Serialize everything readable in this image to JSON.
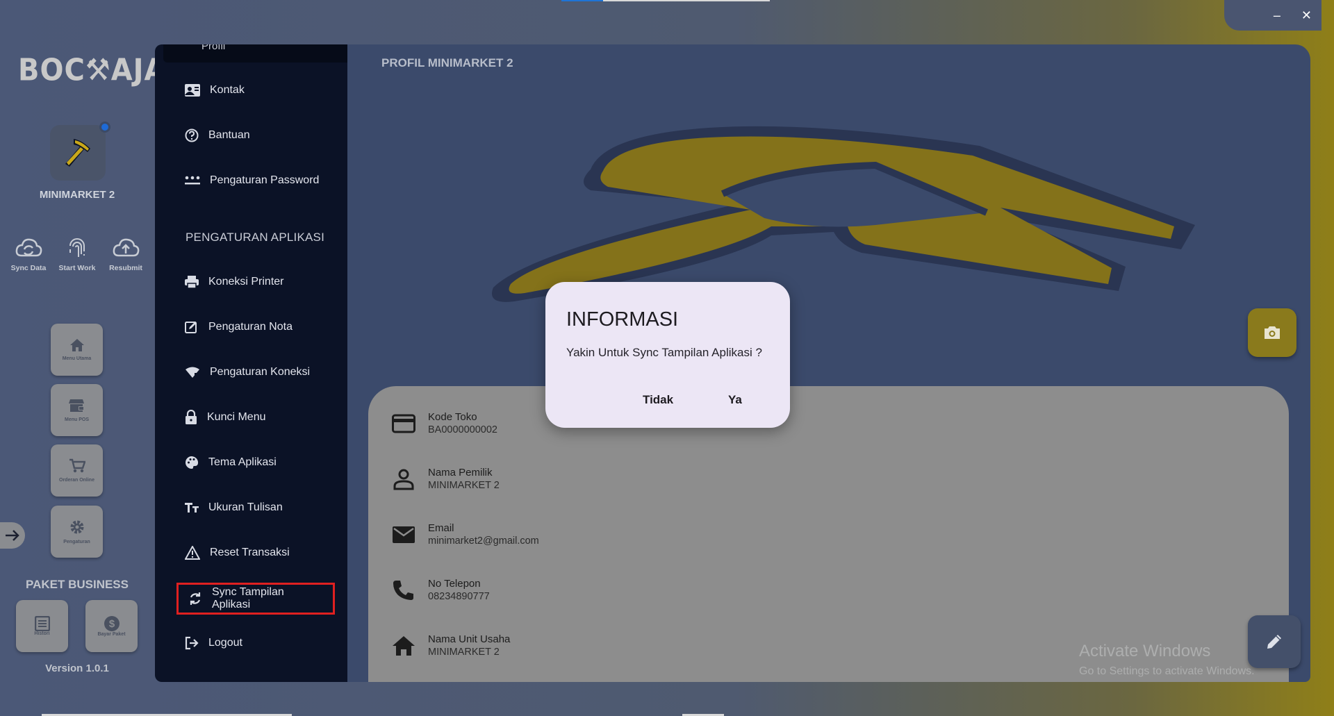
{
  "window": {
    "minimize_label": "–",
    "close_label": "✕"
  },
  "rail": {
    "logo_text": "BOC⚒AJA",
    "store_name": "MINIMARKET 2",
    "quick_actions": [
      {
        "label": "Sync Data",
        "icon": "cloud-sync-icon"
      },
      {
        "label": "Start Work",
        "icon": "fingerprint-icon"
      },
      {
        "label": "Resubmit",
        "icon": "cloud-upload-icon"
      }
    ],
    "tiles": [
      {
        "label": "Menu Utama",
        "icon": "home-icon"
      },
      {
        "label": "Menu POS",
        "icon": "store-icon"
      },
      {
        "label": "Orderan Online",
        "icon": "cart-icon"
      },
      {
        "label": "Pengaturan",
        "icon": "gear-icon"
      }
    ],
    "paket_label": "PAKET BUSINESS",
    "paket_tiles": [
      {
        "label": "Histori",
        "icon": "list-icon"
      },
      {
        "label": "Bayar Paket",
        "icon": "dollar-icon"
      }
    ],
    "version": "Version 1.0.1"
  },
  "menu": {
    "top_item": "Profil",
    "items_account": [
      "Kontak",
      "Bantuan",
      "Pengaturan Password"
    ],
    "section_title": "PENGATURAN APLIKASI",
    "items_app": [
      "Koneksi Printer",
      "Pengaturan Nota",
      "Pengaturan Koneksi",
      "Kunci Menu",
      "Tema Aplikasi",
      "Ukuran Tulisan",
      "Reset Transaksi",
      "Sync Tampilan Aplikasi",
      "Logout"
    ],
    "highlight_color": "#e02020"
  },
  "main": {
    "title": "PROFIL MINIMARKET 2",
    "fields": [
      {
        "label": "Kode Toko",
        "value": "BA0000000002",
        "icon": "card-icon"
      },
      {
        "label": "Nama Pemilik",
        "value": "MINIMARKET 2",
        "icon": "person-icon"
      },
      {
        "label": "Email",
        "value": "minimarket2@gmail.com",
        "icon": "mail-icon"
      },
      {
        "label": "No Telepon",
        "value": "08234890777",
        "icon": "phone-icon"
      },
      {
        "label": "Nama Unit Usaha",
        "value": "MINIMARKET 2",
        "icon": "home-icon"
      }
    ]
  },
  "watermark": {
    "line1": "Activate Windows",
    "line2": "Go to Settings to activate Windows."
  },
  "dialog": {
    "title": "INFORMASI",
    "message": "Yakin Untuk Sync Tampilan Aplikasi ?",
    "cancel_label": "Tidak",
    "confirm_label": "Ya"
  },
  "colors": {
    "accent_yellow": "#8a7a1c",
    "panel_dark": "#0b1226",
    "main_bg": "#3b4a6b"
  }
}
